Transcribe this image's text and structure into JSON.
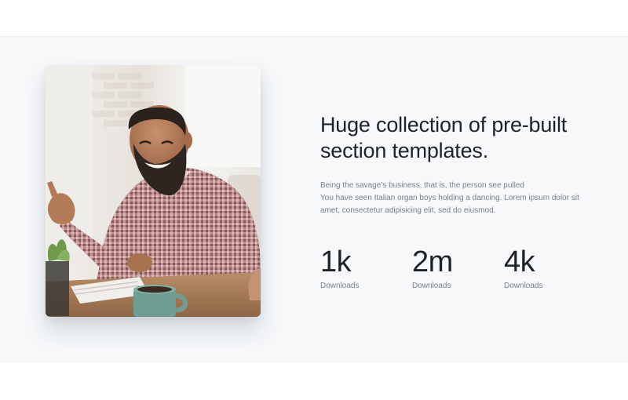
{
  "feature": {
    "photo": {
      "alt": "Smiling man in checkered shirt gesturing at a desk"
    },
    "headline_line1": "Huge collection of pre-built",
    "headline_line2": "section templates.",
    "body_line1": "Being the savage’s business, that is, the person see pulled",
    "body_line2": "You have seen Italian organ boys holding a dancing. Lorem ipsum dolor sit",
    "body_line3": "amet, consectetur adipisicing elit, sed do eiusmod.",
    "stats": [
      {
        "value": "1k",
        "label": "Downloads"
      },
      {
        "value": "2m",
        "label": "Downloads"
      },
      {
        "value": "4k",
        "label": "Downloads"
      }
    ]
  },
  "colors": {
    "section_bg": "#f6f8fa",
    "heading": "#1f2329",
    "muted": "#7b8088"
  }
}
